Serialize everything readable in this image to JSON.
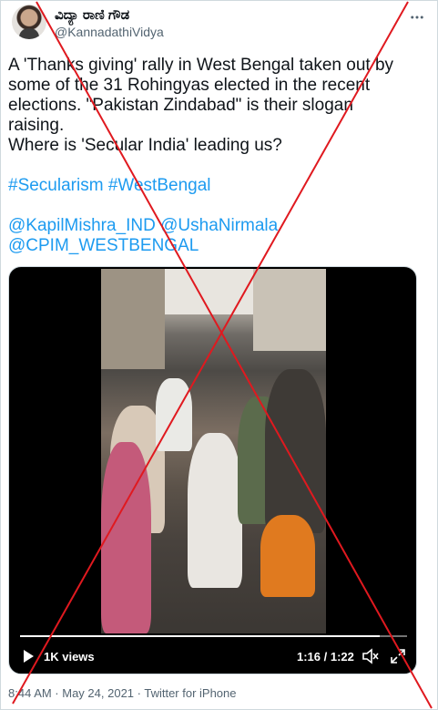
{
  "author": {
    "display_name": "ವಿದ್ಯಾ ರಾಣಿ ಗೌಡ",
    "handle": "@KannadathiVidya"
  },
  "tweet": {
    "lines": [
      "A 'Thanks giving' rally in West Bengal taken out by",
      "some of the 31 Rohingyas elected in the recent",
      "elections. \"Pakistan Zindabad\" is their slogan",
      "raising.",
      "Where is 'Secular India' leading us?"
    ],
    "hashtags": [
      "#Secularism",
      "#WestBengal"
    ],
    "mentions_line1": [
      "@KapilMishra_IND",
      "@UshaNirmala"
    ],
    "mentions_line2": [
      "@CPIM_WESTBENGAL"
    ]
  },
  "video": {
    "views": "1K views",
    "time": "1:16 / 1:22",
    "progress": 0.93
  },
  "footer": {
    "meta": "8:44 AM · May 24, 2021 · Twitter for iPhone"
  },
  "colors": {
    "link": "#1d9bf0",
    "cross": "#e0191f",
    "secondary_text": "#536471"
  },
  "icons": {
    "more": "more-icon",
    "play": "play-icon",
    "mute": "mute-icon",
    "fullscreen": "fullscreen-icon"
  }
}
